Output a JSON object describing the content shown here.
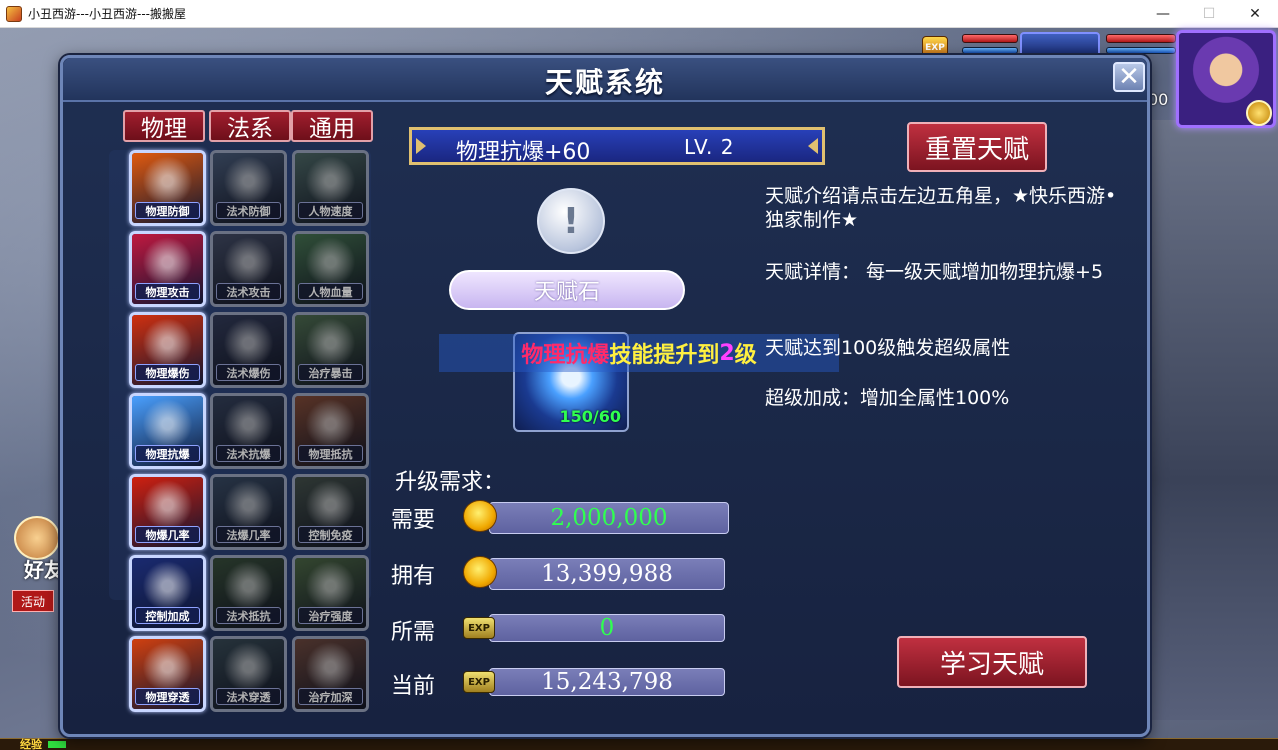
{
  "window": {
    "title": "小丑西游---小丑西游---搬搬屋",
    "minimize": "—",
    "maximize": "☐",
    "close": "✕"
  },
  "scene": {
    "exp_badge": "EXP",
    "behind_text": "00",
    "friend_label": "好友",
    "activity_label": "活动",
    "exp_label": "经验"
  },
  "dialog": {
    "title": "天赋系统",
    "close": "✕",
    "tabs": [
      {
        "label": "物理"
      },
      {
        "label": "法系"
      },
      {
        "label": "通用"
      }
    ],
    "skills": [
      {
        "label": "物理防御",
        "color": "#e05a10"
      },
      {
        "label": "法术防御",
        "color": "#3a5a90"
      },
      {
        "label": "人物速度",
        "color": "#3a6a68"
      },
      {
        "label": "物理攻击",
        "color": "#c01840"
      },
      {
        "label": "法术攻击",
        "color": "#3a4a78"
      },
      {
        "label": "人物血量",
        "color": "#2a7a40"
      },
      {
        "label": "物理爆伤",
        "color": "#d03010"
      },
      {
        "label": "法术爆伤",
        "color": "#2a3a70"
      },
      {
        "label": "治疗暴击",
        "color": "#3a7040"
      },
      {
        "label": "物理抗爆",
        "color": "#4aa0ff"
      },
      {
        "label": "法术抗爆",
        "color": "#2a4070"
      },
      {
        "label": "物理抵抗",
        "color": "#a04020"
      },
      {
        "label": "物爆几率",
        "color": "#d02010"
      },
      {
        "label": "法爆几率",
        "color": "#2a4a78"
      },
      {
        "label": "控制免疫",
        "color": "#3a5048"
      },
      {
        "label": "控制加成",
        "color": "#1a2a70"
      },
      {
        "label": "法术抵抗",
        "color": "#2a5030"
      },
      {
        "label": "治疗强度",
        "color": "#3a6a30"
      },
      {
        "label": "物理穿透",
        "color": "#d04010"
      },
      {
        "label": "法术穿透",
        "color": "#2a4a60"
      },
      {
        "label": "治疗加深",
        "color": "#804030"
      }
    ],
    "selected": {
      "name": "物理抗爆+60",
      "level": "LV. 2"
    },
    "reset_button": "重置天赋",
    "learn_button": "学习天赋",
    "info_icon": "!",
    "stone_label": "天赋石",
    "item_count": "150/60",
    "upgrade_banner": {
      "part1": "物理抗爆",
      "part2": "技能提升到",
      "part3": "2",
      "part4": "级"
    },
    "description": {
      "intro": "天赋介绍请点击左边五角星，★快乐西游•独家制作★",
      "detail": "天赋详情：  每一级天赋增加物理抗爆+5",
      "trigger": "天赋达到100级触发超级属性",
      "bonus": "超级加成：增加全属性100%"
    },
    "requirements": {
      "title": "升级需求：",
      "rows": [
        {
          "label": "需要",
          "value": "2,000,000",
          "icon": "gold-coin-icon"
        },
        {
          "label": "拥有",
          "value": "13,399,988",
          "icon": "gold-coin-icon"
        },
        {
          "label": "所需",
          "value": "0",
          "icon": "exp-icon"
        },
        {
          "label": "当前",
          "value": "15,243,798",
          "icon": "exp-icon"
        }
      ],
      "exp_badge": "EXP"
    }
  }
}
